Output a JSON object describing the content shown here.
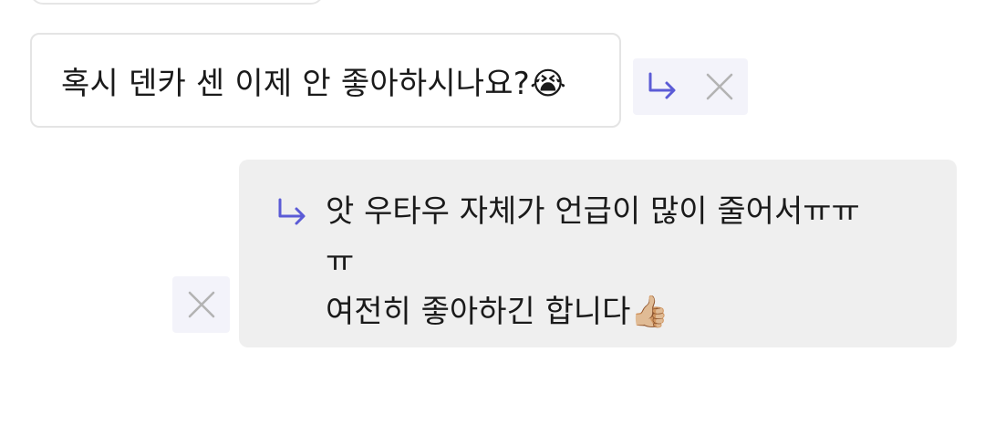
{
  "previous_message": {
    "text": ""
  },
  "incoming": {
    "text": "혹시 덴카 센 이제 안 좋아하시나요?😭"
  },
  "incoming_actions": {
    "reply_icon": "reply-arrow-icon",
    "close_icon": "close-icon"
  },
  "reply": {
    "reply_icon": "reply-arrow-icon",
    "lines": [
      "앗 우타우 자체가 언급이 많이 줄어서ㅠㅠ",
      "ㅠ",
      "여전히 좋아하긴 합니다👍🏼"
    ]
  },
  "reply_actions": {
    "close_icon": "close-icon"
  },
  "colors": {
    "accent": "#5b5bd6",
    "icon_gray": "#b3b3b3",
    "action_bg": "#f3f3fa",
    "bubble_out_bg": "#efefef",
    "bubble_in_border": "#e4e4e4"
  }
}
